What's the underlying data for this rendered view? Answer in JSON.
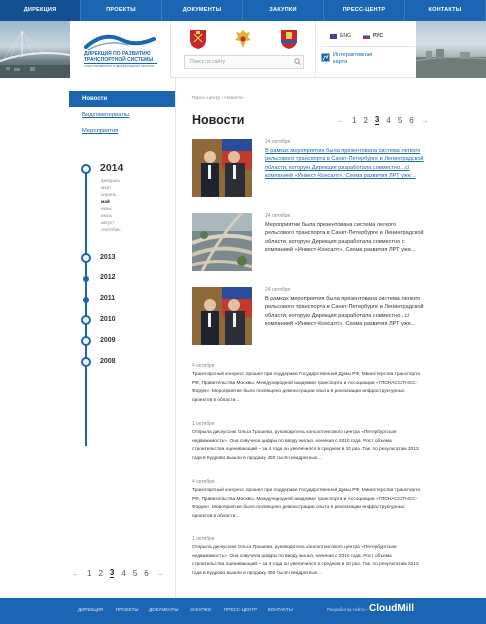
{
  "nav": [
    {
      "label": "ДИРЕКЦИЯ",
      "active": true
    },
    {
      "label": "ПРОЕКТЫ",
      "active": false
    },
    {
      "label": "ДОКУМЕНТЫ",
      "active": false
    },
    {
      "label": "ЗАКУПКИ",
      "active": false
    },
    {
      "label": "ПРЕСС-ЦЕНТР",
      "active": false
    },
    {
      "label": "КОНТАКТЫ",
      "active": false
    }
  ],
  "logo": {
    "title": "ДИРЕКЦИЯ ПО РАЗВИТИЮ ТРАНСПОРТНОЙ СИСТЕМЫ",
    "subtitle": "САНКТ-ПЕТЕРБУРГА И ЛЕНИНГРАДСКОЙ ОБЛАСТИ"
  },
  "search": {
    "placeholder": "Поиск по сайту"
  },
  "lang": {
    "en": "ENG",
    "ru": "РУС"
  },
  "map_link": "Интерактивная карта",
  "sidebar": {
    "active": "Новости",
    "links": [
      "Видеоматериалы",
      "Мероприятия"
    ]
  },
  "timeline": {
    "current_year": "2014",
    "months": [
      "февраль",
      "март",
      "апрель",
      "май",
      "июнь",
      "июль",
      "август",
      "сентябрь"
    ],
    "active_month": "май",
    "years": [
      "2013",
      "2012",
      "2011",
      "2010",
      "2009",
      "2008"
    ]
  },
  "pagination": [
    "1",
    "2",
    "3",
    "4",
    "5",
    "6"
  ],
  "pagination_active": "3",
  "breadcrumb": "Пресс-центр › Новости",
  "page_title": "Новости",
  "news_with_images": [
    {
      "date": "24 октября",
      "text": "В рамках мероприятия была презентована система легкого рельсового транспорта в Санкт-Петербурге и Ленинградской области, которую Дирекция разработала совместно...с/ компанией «Инвест-Консалт». Схема развития ЛРТ уже...",
      "link": true
    },
    {
      "date": "24 октября",
      "text": "Мероприятии была презентована система легкого рельсового транспорта в Санкт-Петербурге и Ленинградской области, которую Дирекция разработала совместно с компанией «Инвест-Консалт». Схема развития ЛРТ уже...",
      "link": false
    },
    {
      "date": "24 октября",
      "text": "В рамках мероприятия была презентована система легкого рельсового транспорта в Санкт-Петербурге и Ленинградской области, которую Дирекция разработала совместно...с/ компанией «Инвест-Консалт». Схема развития ЛРТ уже...",
      "link": false
    }
  ],
  "news_text_only": [
    {
      "date": "4 октября",
      "text": "Транспортный конгресс прошел при поддержке Государственной Думы РФ, Министерства транспорта РФ, Правительства Москвы, Международной академии транспорта и Ассоциации «ГЛОНАСС/ГНСС-Форум». Мероприятие было посвящено демонстрации опыта в реализации инфраструктурных проектов в области..."
    },
    {
      "date": "1 октября",
      "text": "Открыла дискуссию Ольга Трошева, руководитель консалтингового центра «Петербургская недвижимость». Она озвучила цифры по вводу жилья, начиная с 2010 года. Рост объема строительства оценивающий – за 4 года он увеличился в среднем в 10 раз. Так, по результатам 2013 года в Кудрово вышли в продажу 450 тысяч квадратных..."
    },
    {
      "date": "4 октября",
      "text": "Транспортный конгресс прошел при поддержке Государственной Думы РФ, Министерства транспорта РФ, Правительства Москвы, Международной академии транспорта и Ассоциации «ГЛОНАСС/ГНСС-Форум». Мероприятие было посвящено демонстрации опыта в реализации инфраструктурных проектов в области..."
    },
    {
      "date": "1 октября",
      "text": "Открыла дискуссию Ольга Трошева, руководитель консалтингового центра «Петербургская недвижимость». Она озвучила цифры по вводу жилья, начиная с 2010 года. Рост объема строительства оценивающий – за 4 года он увеличился в среднем в 10 раз. Так, по результатам 2013 года в Кудрово вышли в продажу 450 тысяч квадратных..."
    }
  ],
  "footer": {
    "items": [
      "ДИРЕКЦИЯ",
      "ПРОЕКТЫ",
      "ДОКУМЕНТЫ",
      "ЗАКУПКИ",
      "ПРЕСС-ЦЕНТР",
      "КОНТАКТЫ"
    ],
    "dev_label": "Разработка сайта –",
    "brand": "CloudMill"
  },
  "colors": {
    "primary": "#1b66b3",
    "footer": "#1b66b3"
  }
}
